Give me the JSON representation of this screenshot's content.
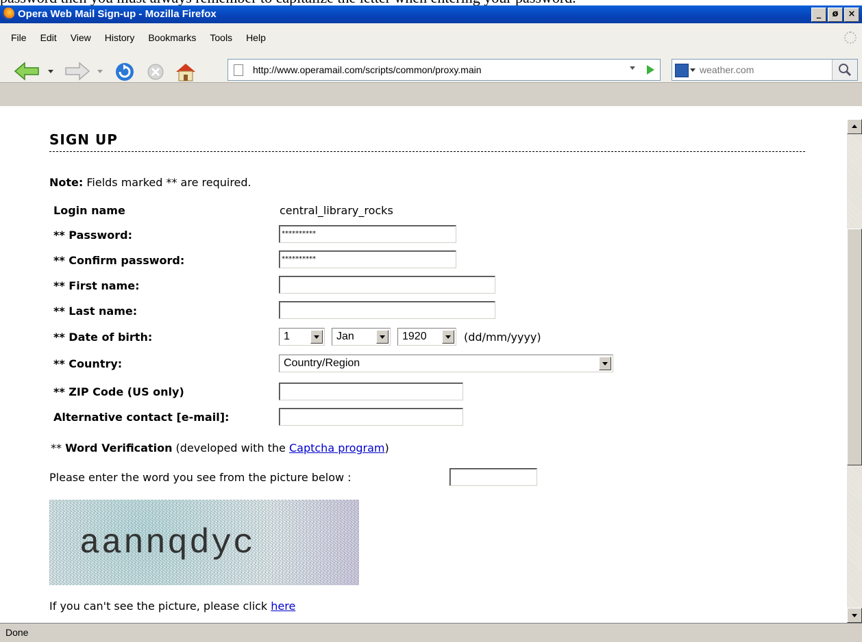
{
  "doc_overtext": "password then you must always remember to capitalize the letter when entering your password.",
  "window": {
    "title": "Opera Web Mail Sign-up - Mozilla Firefox",
    "min": "_",
    "max": "ø",
    "close": "×"
  },
  "menu": [
    "File",
    "Edit",
    "View",
    "History",
    "Bookmarks",
    "Tools",
    "Help"
  ],
  "nav": {
    "url": "http://www.operamail.com/scripts/common/proxy.main",
    "search_text": "weather.com"
  },
  "page": {
    "heading": "SIGN UP",
    "note_label": "Note:",
    "note_text": " Fields marked ** are required.",
    "rows": {
      "login_label": "Login name",
      "login_value": "central_library_rocks",
      "password_label": "** Password:",
      "password_value": "**********",
      "confirm_label": "** Confirm password:",
      "confirm_value": "**********",
      "first_label": "** First name:",
      "last_label": "** Last name:",
      "dob_label": "** Date of birth:",
      "dob_day": "1",
      "dob_month": "Jan",
      "dob_year": "1920",
      "dob_hint": "(dd/mm/yyyy)",
      "country_label": "** Country:",
      "country_value": "Country/Region",
      "zip_label": "** ZIP Code (US only)",
      "alt_label": "Alternative contact [e-mail]:"
    },
    "verification_prefix": "** ",
    "verification_bold": "Word Verification",
    "verification_mid": " (developed with the ",
    "verification_link": "Captcha program",
    "verification_end": ")",
    "enter_word": "Please enter the word you see from the picture below :",
    "captcha_word": "aannqdyc",
    "cant_see": "If you can't see the picture, please click ",
    "cant_see_link": "here"
  },
  "status": "Done"
}
